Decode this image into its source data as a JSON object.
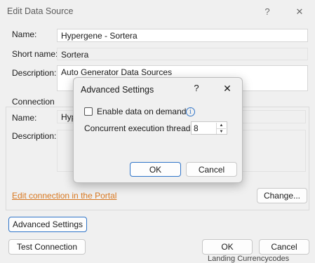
{
  "main_dialog": {
    "title": "Edit Data Source",
    "help": "?",
    "close": "✕",
    "name_label": "Name:",
    "name_value": "Hypergene - Sortera",
    "short_name_label": "Short name:",
    "short_name_value": "Sortera",
    "description_label": "Description:",
    "description_value": "Auto Generator Data Sources",
    "connection_label": "Connection",
    "conn_name_label": "Name:",
    "conn_name_value": "Hyp",
    "conn_description_label": "Description:",
    "portal_link": "Edit connection in the Portal",
    "change_button": "Change...",
    "advanced_button": "Advanced Settings",
    "test_button": "Test Connection",
    "ok_button": "OK",
    "cancel_button": "Cancel"
  },
  "advanced_dialog": {
    "title": "Advanced Settings",
    "help": "?",
    "close": "✕",
    "enable_demand_label": "Enable data on demand",
    "enable_demand_checked": false,
    "threads_label": "Concurrent execution threads:",
    "threads_value": "8",
    "ok_button": "OK",
    "cancel_button": "Cancel"
  },
  "background_text": "Landing Currencycodes",
  "colors": {
    "accent": "#2f74c8",
    "link": "#d8771f"
  },
  "icons": [
    "help-icon",
    "close-icon",
    "info-icon",
    "spin-up-icon",
    "spin-down-icon"
  ]
}
